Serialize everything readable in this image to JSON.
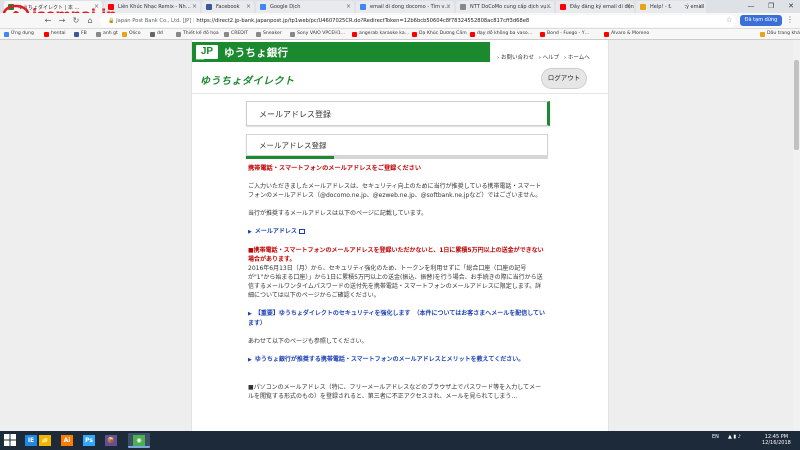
{
  "browser": {
    "tabs": [
      {
        "label": "ゆうちょダイレクト | 本 …",
        "fav_color": "#1b8a2e",
        "active": true
      },
      {
        "label": "Liên Khúc Nhạc Remix - Nh…",
        "fav_color": "#ff0000",
        "active": false
      },
      {
        "label": "Facebook",
        "fav_color": "#3b5998",
        "active": false
      },
      {
        "label": "Google Dịch",
        "fav_color": "#4285f4",
        "active": false
      },
      {
        "label": "email di dong docomo - Tìm v…",
        "fav_color": "#4285f4",
        "active": false
      },
      {
        "label": "NTT DoCoMo cung cấp dịch vụ…",
        "fav_color": "#888888",
        "active": false
      },
      {
        "label": "Đây đăng ký email di động Nh…",
        "fav_color": "#ff0000",
        "active": false
      },
      {
        "label": "Help! - Đăng ký email | Diễn Đà…",
        "fav_color": "#e8a317",
        "active": false
      }
    ],
    "address_prefix": "Japan Post Bank Co., Ltd. [JP]",
    "url": "https://direct2.jp-bank.japanpost.jp/tp1web/pc/U4607025CR.do?RedirectToken=12b6bcb50604c8f78324552808ac817cff3d68e8",
    "profile_label": "Đã tạm dừng",
    "window_controls": [
      "—",
      "❐",
      "✕"
    ],
    "bookmarks": [
      {
        "label": "Ứng dụng",
        "color": "#4285f4"
      },
      {
        "label": "hentai",
        "color": "#ff0000"
      },
      {
        "label": "FB",
        "color": "#3b5998"
      },
      {
        "label": "anh gt",
        "color": "#888888"
      },
      {
        "label": "Olico",
        "color": "#e8a317"
      },
      {
        "label": "dd",
        "color": "#666666"
      },
      {
        "label": "Thiết kế đồ họa",
        "color": "#888888"
      },
      {
        "label": "CREDIT",
        "color": "#888888"
      },
      {
        "label": "Sneaker",
        "color": "#888888"
      },
      {
        "label": "Sony VAIO VPCEH1…",
        "color": "#888888"
      },
      {
        "label": "angerab karaoke ka…",
        "color": "#ff0000"
      },
      {
        "label": "Dạ Khúc Dương Cầm",
        "color": "#ff0000"
      },
      {
        "label": "dạy dỗ không ba vaso…",
        "color": "#ff0000"
      },
      {
        "label": "Bond - Fuego - Y…",
        "color": "#ff0000"
      },
      {
        "label": "Alvaro & Moreno",
        "color": "#ff0000"
      },
      {
        "label": "Dấu trang khác",
        "color": "#e8a317"
      }
    ]
  },
  "overlay_logo": {
    "text": "isempai.jp"
  },
  "header": {
    "bank_mark": "JP",
    "bank_mark_sub": "BANK",
    "bank_name": "ゆうちょ銀行",
    "links": [
      "› お問い合わせ",
      "› ヘルプ",
      "› ホームへ"
    ],
    "direct_logo": "ゆうちょダイレクト",
    "logout": "ログアウト"
  },
  "page": {
    "title": "メールアドレス登録",
    "tab_title": "メールアドレス登録",
    "heading": "携帯電話・スマートフォンのメールアドレスをご登録ください",
    "para1": "ご入力いただきましたメールアドレスは、セキュリティ向上のために当行が推奨している携帯電話・スマートフォンのメールアドレス（@docomo.ne.jp、@ezweb.ne.jp、@softbank.ne.jpなど）ではございません。",
    "para2": "当行が推奨するメールアドレスは以下のページに記載しています。",
    "link1": "メールアドレス",
    "warning": "■携帯電話・スマートフォンのメールアドレスを登録いただかないと、1日に累積5万円以上の送金ができない場合があります。",
    "para3": "2016年6月13日（月）から、セキュリティ強化のため、トークンを利用せずに「総合口座（口座の記号が\"1\"から始まる口座）」から1日に累積5万円以上の送金(振込、振替)を行う場合、お手続きの際に当行から送信するメールワンタイムパスワードの送付先を携帯電話・スマートフォンのメールアドレスに限定します。詳細については以下のページからご確認ください。",
    "link2": "【重要】ゆうちょダイレクトのセキュリティを強化します　（本件についてはお客さまへメールを配信しています）",
    "para4": "あわせて以下のページも参照してください。",
    "link3": "ゆうちょ銀行が推奨する携帯電話・スマートフォンのメールアドレスとメリットを教えてください。",
    "para5": "■パソコンのメールアドレス（特に、フリーメールアドレスなどのブラウザ上でパスワード等を入力してメールを閲覧する形式のもの）を登録されると、第三者に不正アクセスされ、メールを見られてしまう…"
  },
  "taskbar": {
    "apps": [
      {
        "label": "IE",
        "color": "#1e88e5"
      },
      {
        "label": "📁",
        "color": "#f2b600"
      },
      {
        "label": "Ai",
        "color": "#ff7c00"
      },
      {
        "label": "Ps",
        "color": "#31a8ff"
      },
      {
        "label": "📦",
        "color": "#6a4c93"
      },
      {
        "label": "◉",
        "color": "#4caf50"
      }
    ],
    "lang": "EN",
    "time": "12:45 PM",
    "date": "12/16/2018"
  }
}
